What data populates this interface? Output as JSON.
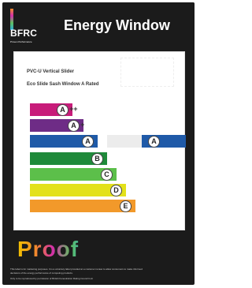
{
  "header": {
    "logo_text": "BFRC",
    "logo_sub": "Proven Performance",
    "title": "Energy Window"
  },
  "panel": {
    "product_line": "PVC-U Vertical Slider",
    "product_name": "Eco Slide Sash Window A Rated"
  },
  "ratings": [
    {
      "grade": "A",
      "suffix": "++",
      "color": "#c81c7a"
    },
    {
      "grade": "A",
      "suffix": "+",
      "color": "#6e2c86"
    },
    {
      "grade": "A",
      "suffix": "",
      "color": "#1f5aa8"
    },
    {
      "grade": "B",
      "suffix": "",
      "color": "#1f8a3a"
    },
    {
      "grade": "C",
      "suffix": "",
      "color": "#5cbf4a"
    },
    {
      "grade": "D",
      "suffix": "",
      "color": "#e3e11a"
    },
    {
      "grade": "E",
      "suffix": "",
      "color": "#f2992a"
    }
  ],
  "indicator": {
    "grade": "A"
  },
  "stamp": {
    "text": "Proof"
  },
  "footer": {
    "line1": "This label is for marketing purposes. It is a voluntary label provided at a customer review to allow consumers to make informed",
    "line2": "decisions of the energy performance of competing products.",
    "line3": "Only to be reproduced by permission of British Fenestration Rating Council Ltd."
  },
  "colors": {
    "background": "#1b1b1b",
    "panel": "#ffffff"
  }
}
